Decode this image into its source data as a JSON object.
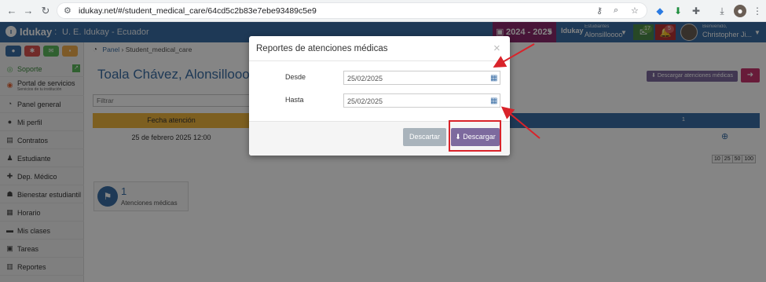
{
  "browser": {
    "url": "idukay.net/#/student_medical_care/64cd5c2b83e7ebe93489c5e9"
  },
  "header": {
    "logo_text": "Idukay",
    "separator": ":",
    "school": "U. E. Idukay - Ecuador",
    "year": "2024 - 2025",
    "student_label": "Estudiantes",
    "student_name": "Alonsilloooo",
    "messages_count": "17",
    "notifications_count": "5",
    "welcome_label": "Bienvenido,",
    "user_name": "Christopher Ji..."
  },
  "sidebar": {
    "items": [
      {
        "label": "Soporte",
        "icon": "support-icon"
      },
      {
        "label": "Portal de servicios",
        "sub": "Servicios de tu institución",
        "icon": "portal-icon"
      },
      {
        "label": "Panel general",
        "icon": "dashboard-icon"
      },
      {
        "label": "Mi perfil",
        "icon": "user-icon"
      },
      {
        "label": "Contratos",
        "icon": "file-icon"
      },
      {
        "label": "Estudiante",
        "icon": "student-icon"
      },
      {
        "label": "Dep. Médico",
        "icon": "medical-icon"
      },
      {
        "label": "Bienestar estudiantil",
        "icon": "wellbeing-icon"
      },
      {
        "label": "Horario",
        "icon": "calendar-icon"
      },
      {
        "label": "Mis clases",
        "icon": "folder-icon"
      },
      {
        "label": "Tareas",
        "icon": "tasks-icon"
      },
      {
        "label": "Reportes",
        "icon": "reports-icon"
      }
    ]
  },
  "breadcrumb": {
    "home": "Panel",
    "current": "Student_medical_care"
  },
  "main": {
    "title": "Toala Chávez, Alonsilloooo Fran",
    "download_button": "Descargar atenciones médicas",
    "filter_placeholder": "Filtrar",
    "column_header": "Fecha atención",
    "row_date": "25 de febrero 2025 12:00",
    "pager": [
      "10",
      "25",
      "50",
      "100"
    ],
    "stat_number": "1",
    "stat_label": "Atenciones médicas"
  },
  "modal": {
    "title": "Reportes de atenciones médicas",
    "close": "×",
    "from_label": "Desde",
    "from_value": "25/02/2025",
    "to_label": "Hasta",
    "to_value": "25/02/2025",
    "cancel_button": "Descartar",
    "download_button": "Descargar"
  },
  "colors": {
    "brand_blue": "#3a6ea5",
    "purple": "#7d6a9e",
    "magenta": "#8a2a6b",
    "pink": "#c8356e",
    "gold": "#f0b63f",
    "annotation_red": "#d9232a"
  }
}
